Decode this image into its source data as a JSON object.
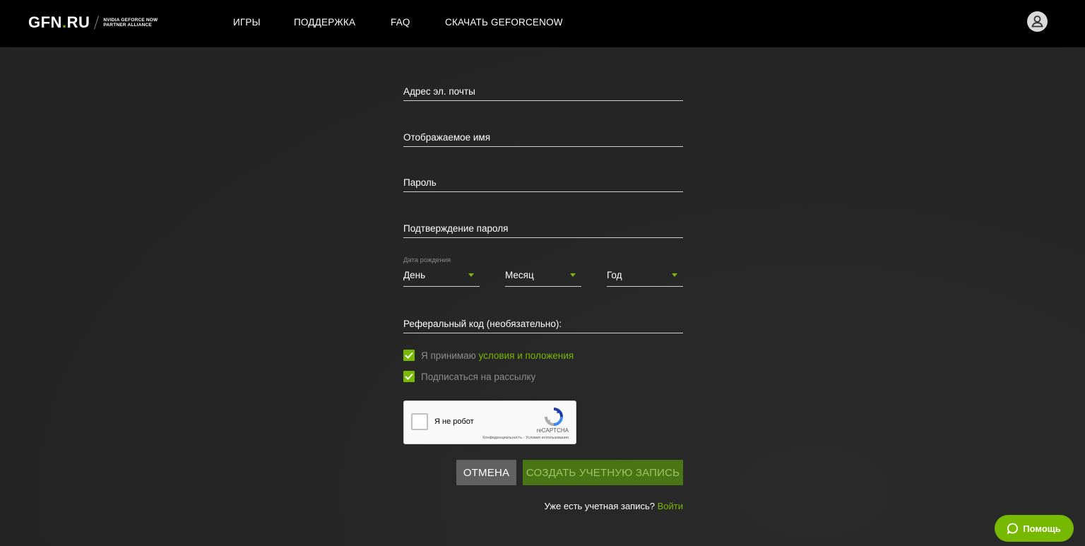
{
  "header": {
    "logo_text": "GFN",
    "logo_dot": ".",
    "logo_suffix": "RU",
    "logo_sub_line1": "NVIDIA GEFORCE NOW",
    "logo_sub_line2": "PARTNER ALLIANCE",
    "nav": [
      {
        "label": "ИГРЫ"
      },
      {
        "label": "ПОДДЕРЖКА"
      },
      {
        "label": "FAQ"
      },
      {
        "label": "СКАЧАТЬ GEFORCENOW"
      }
    ],
    "avatar_icon": "user-icon"
  },
  "form": {
    "email_label": "Адрес эл. почты",
    "display_name_label": "Отображаемое имя",
    "password_label": "Пароль",
    "confirm_password_label": "Подтверждение пароля",
    "dob_caption": "Дата рождения",
    "day_label": "День",
    "month_label": "Месяц",
    "year_label": "Год",
    "referral_label": "Реферальный код (необязательно):",
    "terms_prefix": "Я принимаю ",
    "terms_link": "условия и положения",
    "terms_checked": true,
    "newsletter_label": "Подписаться на рассылку",
    "newsletter_checked": true
  },
  "captcha": {
    "label": "Я не робот",
    "brand": "reCAPTCHA",
    "privacy_link": "Конфиденциальность",
    "separator": " - ",
    "terms_link": "Условия использования"
  },
  "buttons": {
    "cancel_label": "ОТМЕНА",
    "create_label": "СОЗДАТЬ УЧЕТНУЮ ЗАПИСЬ"
  },
  "login": {
    "prompt": "Уже есть учетная запись? ",
    "link": "Войти"
  },
  "help": {
    "label": "Помощь",
    "icon": "chat-bubble-icon"
  },
  "colors": {
    "accent": "#76b900",
    "header_bg": "#000000",
    "page_bg": "#262626",
    "cancel_bg": "#616161",
    "create_bg": "#4a7514"
  }
}
